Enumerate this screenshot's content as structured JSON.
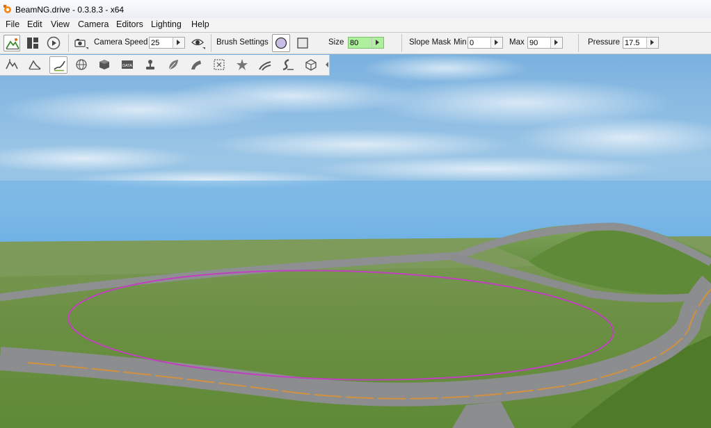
{
  "window": {
    "title": "BeamNG.drive - 0.3.8.3 - x64"
  },
  "menu": [
    "File",
    "Edit",
    "View",
    "Camera",
    "Editors",
    "Lighting",
    "Help"
  ],
  "toolbar": {
    "camera_speed_label": "Camera Speed",
    "camera_speed_value": "25",
    "brush_settings_label": "Brush Settings",
    "size_label": "Size",
    "size_value": "80",
    "slope_mask_label": "Slope Mask",
    "min_label": "Min",
    "min_value": "0",
    "max_label": "Max",
    "max_value": "90",
    "pressure_label": "Pressure",
    "pressure_value": "17.5",
    "highlight_color": "#99ee88"
  },
  "palette": {
    "items": [
      {
        "icon": "terrain-raise-icon"
      },
      {
        "icon": "terrain-smooth-icon"
      },
      {
        "icon": "terrain-paint-brush-icon"
      },
      {
        "icon": "globe-icon"
      },
      {
        "icon": "cube-icon"
      },
      {
        "icon": "data-icon",
        "text": "DATA"
      },
      {
        "icon": "joystick-icon"
      },
      {
        "icon": "leaf-icon"
      },
      {
        "icon": "road-icon"
      },
      {
        "icon": "bounds-icon"
      },
      {
        "icon": "decal-icon"
      },
      {
        "icon": "mesh-road-icon"
      },
      {
        "icon": "river-icon"
      },
      {
        "icon": "gizmo-icon"
      }
    ]
  },
  "viewport": {
    "brush_color": "#c040c0"
  }
}
